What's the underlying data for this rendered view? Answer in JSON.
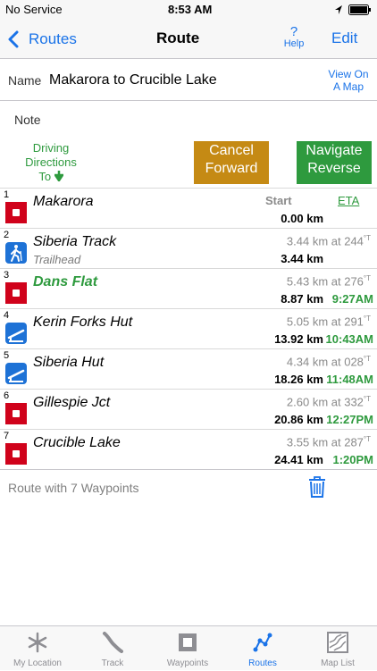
{
  "status": {
    "carrier": "No Service",
    "time": "8:53 AM"
  },
  "nav": {
    "back_label": "Routes",
    "title": "Route",
    "help_label": "Help",
    "help_glyph": "?",
    "edit_label": "Edit"
  },
  "name_row": {
    "label": "Name",
    "value": "Makarora to Crucible Lake",
    "view_map_line1": "View On",
    "view_map_line2": "A Map"
  },
  "note_label": "Note",
  "driving": {
    "line1": "Driving",
    "line2": "Directions",
    "line3": "To"
  },
  "cancel_forward": {
    "line1": "Cancel",
    "line2": "Forward",
    "color": "#c58a14"
  },
  "navigate_reverse": {
    "line1": "Navigate",
    "line2": "Reverse",
    "color": "#2e9a3e"
  },
  "waypoints": [
    {
      "index": "1",
      "name": "Makarora",
      "sub": "",
      "icon": "red-square-icon",
      "leg": "",
      "start_label": "Start",
      "eta_header": "ETA",
      "cumulative": "0.00 km",
      "eta": "",
      "highlight": false
    },
    {
      "index": "2",
      "name": "Siberia Track",
      "sub": "Trailhead",
      "icon": "hiker-icon",
      "leg_dist": "3.44 km at 244",
      "leg_unit": "°T",
      "cumulative": "3.44 km",
      "eta": "",
      "highlight": false
    },
    {
      "index": "3",
      "name": "Dans Flat",
      "sub": "",
      "icon": "red-square-icon",
      "leg_dist": "5.43 km at 276",
      "leg_unit": "°T",
      "cumulative": "8.87 km",
      "eta": "9:27AM",
      "highlight": true
    },
    {
      "index": "4",
      "name": "Kerin Forks Hut",
      "sub": "",
      "icon": "hut-icon",
      "leg_dist": "5.05 km at 291",
      "leg_unit": "°T",
      "cumulative": "13.92 km",
      "eta": "10:43AM",
      "highlight": false
    },
    {
      "index": "5",
      "name": "Siberia Hut",
      "sub": "",
      "icon": "hut-icon",
      "leg_dist": "4.34 km at 028",
      "leg_unit": "°T",
      "cumulative": "18.26 km",
      "eta": "11:48AM",
      "highlight": false
    },
    {
      "index": "6",
      "name": "Gillespie Jct",
      "sub": "",
      "icon": "red-square-icon",
      "leg_dist": "2.60 km at 332",
      "leg_unit": "°T",
      "cumulative": "20.86 km",
      "eta": "12:27PM",
      "highlight": false
    },
    {
      "index": "7",
      "name": "Crucible Lake",
      "sub": "",
      "icon": "red-square-icon",
      "leg_dist": "3.55 km at 287",
      "leg_unit": "°T",
      "cumulative": "24.41 km",
      "eta": "1:20PM",
      "highlight": false
    }
  ],
  "footer_text": "Route with 7 Waypoints",
  "tabs": [
    {
      "label": "My Location",
      "icon": "snowflake-icon",
      "active": false
    },
    {
      "label": "Track",
      "icon": "track-icon",
      "active": false
    },
    {
      "label": "Waypoints",
      "icon": "waypoint-square-icon",
      "active": false
    },
    {
      "label": "Routes",
      "icon": "route-icon",
      "active": true
    },
    {
      "label": "Map List",
      "icon": "map-list-icon",
      "active": false
    }
  ],
  "colors": {
    "accent": "#1a73e8",
    "green": "#2e9a3e",
    "red": "#d0021b",
    "gold": "#c58a14"
  }
}
